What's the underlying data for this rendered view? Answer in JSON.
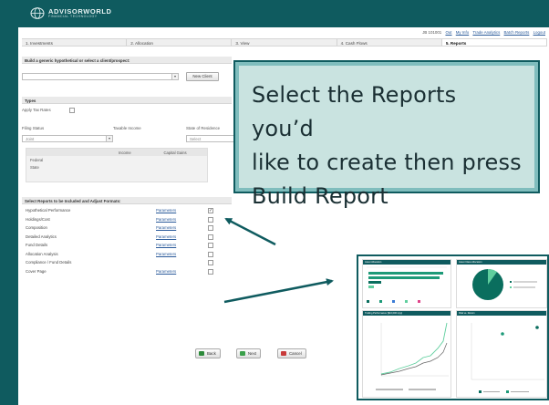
{
  "app": {
    "logo_line1": "ADVISORWORLD",
    "logo_line2": "FINANCIAL TECHNOLOGY"
  },
  "user_bar": {
    "user": "JB 101001",
    "links": [
      "Out",
      "My Info",
      "Trade Analytics",
      "Batch Reports",
      "Logout"
    ]
  },
  "tabs": [
    {
      "label": "1. Investments",
      "active": false
    },
    {
      "label": "2. Allocation",
      "active": false
    },
    {
      "label": "3. View",
      "active": false
    },
    {
      "label": "4. Cash Flows",
      "active": false
    },
    {
      "label": "5. Reports",
      "active": true
    }
  ],
  "prospect_section": {
    "title": "Build a generic hypothetical or select a client/prospect:",
    "new_client_label": "New Client"
  },
  "types_section": {
    "title": "Types",
    "apply_tax_label": "Apply Tax Rates",
    "filing_status_label": "Filing Status",
    "filing_status_value": "Joint",
    "taxable_income_label": "Taxable Income",
    "state_label": "State of Residence",
    "state_value": "Select",
    "grid_headers": [
      "Income",
      "Capital Gains"
    ],
    "grid_rows": [
      "Federal",
      "State"
    ]
  },
  "reports_section": {
    "title": "Select Reports to be Included and Adjust Formats:",
    "params_label": "Parameters",
    "reports": [
      {
        "name": "Hypothetical Performance",
        "has_params": true,
        "checked": true
      },
      {
        "name": "Holdings/Cost",
        "has_params": true,
        "checked": false
      },
      {
        "name": "Composition",
        "has_params": true,
        "checked": false
      },
      {
        "name": "Detailed Analytics",
        "has_params": true,
        "checked": false
      },
      {
        "name": "Fund Details",
        "has_params": true,
        "checked": false
      },
      {
        "name": "Allocation Analysis",
        "has_params": true,
        "checked": false
      },
      {
        "name": "Compliance / Fund Details",
        "has_params": false,
        "checked": false
      },
      {
        "name": "Cover Page",
        "has_params": true,
        "checked": false
      }
    ]
  },
  "buttons": {
    "back": "Back",
    "next": "Next",
    "cancel": "Cancel"
  },
  "callout": {
    "line1": "Select the Reports you’d",
    "line2": "like to create then press",
    "line3": "Build Report"
  },
  "preview": {
    "card1_title": "Asset Allocation",
    "card2_title": "Asset Class Allocation",
    "card3_title": "Trailing Performance ($10,000 Hyp)",
    "card4_title": "Risk vs. Return",
    "colors": {
      "dark": "#0a6e5e",
      "mid": "#1d9a78",
      "light": "#5fcf9e",
      "pink": "#e0438a",
      "blue": "#3a7bd5"
    }
  }
}
